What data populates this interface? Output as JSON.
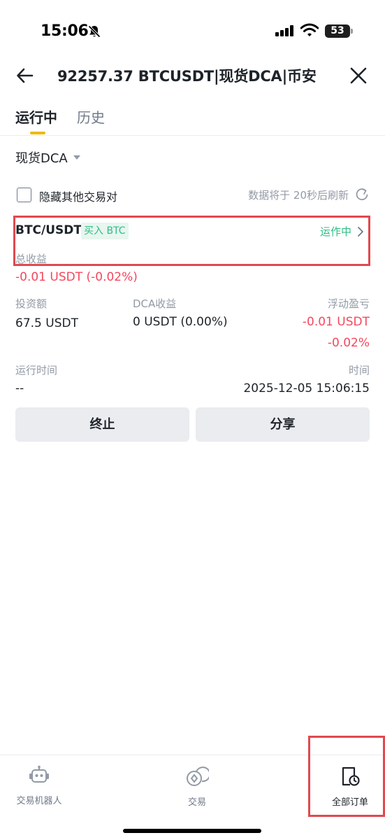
{
  "status_bar": {
    "time": "15:06",
    "battery": "53"
  },
  "nav": {
    "title": "92257.37 BTCUSDT|现货DCA|币安"
  },
  "tabs": [
    {
      "label": "运行中",
      "active": true
    },
    {
      "label": "历史",
      "active": false
    }
  ],
  "filter": {
    "strategy_select": "现货DCA",
    "hide_others_label": "隐藏其他交易对",
    "hide_others_checked": false,
    "refresh_text": "数据将于 20秒后刷新"
  },
  "order": {
    "pair": "BTC/USDT",
    "side_tag": "买入 BTC",
    "status": "运作中",
    "total_profit_label": "总收益",
    "total_profit_value": "-0.01 USDT (-0.02%)",
    "investment_label": "投资额",
    "investment_value": "67.5 USDT",
    "dca_profit_label": "DCA收益",
    "dca_profit_value": "0 USDT (0.00%)",
    "floating_pnl_label": "浮动盈亏",
    "floating_pnl_value": "-0.01 USDT",
    "floating_pnl_pct": "-0.02%",
    "run_time_label": "运行时间",
    "run_time_value": "--",
    "time_label": "时间",
    "time_value": "2025-12-05 15:06:15"
  },
  "actions": {
    "stop": "终止",
    "share": "分享"
  },
  "bottom_nav": [
    {
      "label": "交易机器人",
      "icon": "robot-icon"
    },
    {
      "label": "交易",
      "icon": "trade-icon"
    },
    {
      "label": "全部订单",
      "icon": "all-orders-icon",
      "active": true
    }
  ],
  "colors": {
    "accent": "#f0b90b",
    "positive": "#2ebd85",
    "negative": "#f6465d",
    "highlight_box": "#e0494f"
  }
}
